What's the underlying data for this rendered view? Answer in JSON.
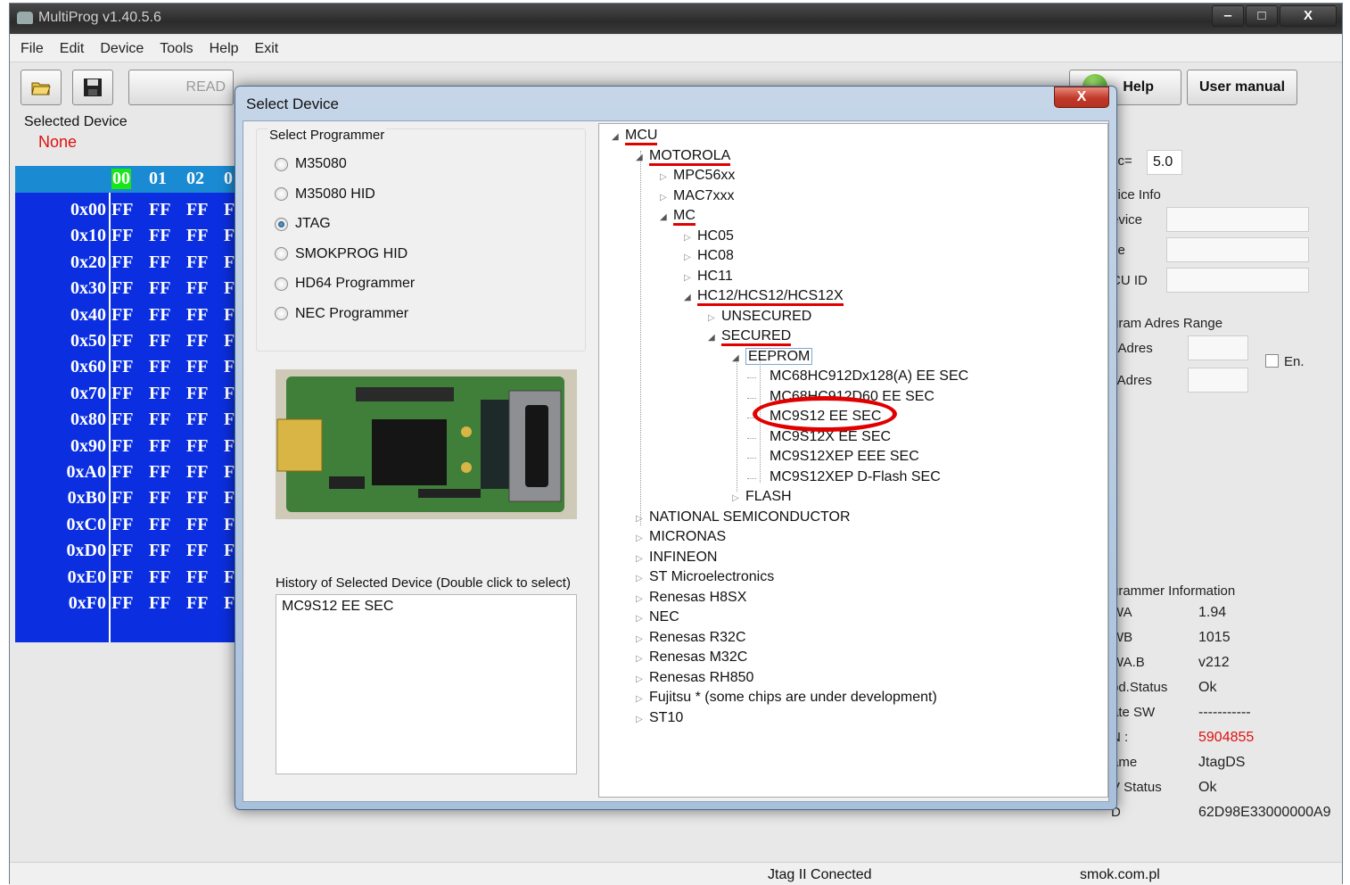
{
  "window": {
    "title": "MultiProg v1.40.5.6",
    "controls": [
      "‒",
      "□",
      "X"
    ]
  },
  "menu": [
    "File",
    "Edit",
    "Device",
    "Tools",
    "Help",
    "Exit"
  ],
  "toolbar": {
    "read_label": "READ",
    "help_label": "Help",
    "manual_label": "User manual"
  },
  "selected_device": {
    "label": "Selected Device",
    "value": "None"
  },
  "hex": {
    "header": [
      "00",
      "01",
      "02",
      "0"
    ],
    "rows": [
      {
        "addr": "0x00",
        "cells": [
          "FF",
          "FF",
          "FF",
          "F"
        ]
      },
      {
        "addr": "0x10",
        "cells": [
          "FF",
          "FF",
          "FF",
          "F"
        ]
      },
      {
        "addr": "0x20",
        "cells": [
          "FF",
          "FF",
          "FF",
          "F"
        ]
      },
      {
        "addr": "0x30",
        "cells": [
          "FF",
          "FF",
          "FF",
          "F"
        ]
      },
      {
        "addr": "0x40",
        "cells": [
          "FF",
          "FF",
          "FF",
          "F"
        ]
      },
      {
        "addr": "0x50",
        "cells": [
          "FF",
          "FF",
          "FF",
          "F"
        ]
      },
      {
        "addr": "0x60",
        "cells": [
          "FF",
          "FF",
          "FF",
          "F"
        ]
      },
      {
        "addr": "0x70",
        "cells": [
          "FF",
          "FF",
          "FF",
          "F"
        ]
      },
      {
        "addr": "0x80",
        "cells": [
          "FF",
          "FF",
          "FF",
          "F"
        ]
      },
      {
        "addr": "0x90",
        "cells": [
          "FF",
          "FF",
          "FF",
          "F"
        ]
      },
      {
        "addr": "0xA0",
        "cells": [
          "FF",
          "FF",
          "FF",
          "F"
        ]
      },
      {
        "addr": "0xB0",
        "cells": [
          "FF",
          "FF",
          "FF",
          "F"
        ]
      },
      {
        "addr": "0xC0",
        "cells": [
          "FF",
          "FF",
          "FF",
          "F"
        ]
      },
      {
        "addr": "0xD0",
        "cells": [
          "FF",
          "FF",
          "FF",
          "F"
        ]
      },
      {
        "addr": "0xE0",
        "cells": [
          "FF",
          "FF",
          "FF",
          "F"
        ]
      },
      {
        "addr": "0xF0",
        "cells": [
          "FF",
          "FF",
          "FF",
          "F"
        ]
      }
    ]
  },
  "right_panel": {
    "vcc_label": "cc=",
    "vcc_value": "5.0",
    "device_info_title": "vice Info",
    "device_label": "evice",
    "size_label": "ze",
    "mcu_id_label": "CU ID",
    "adres_range_title": "gram Adres Range",
    "start_adres_label": "t Adres",
    "end_adres_label": "l  Adres",
    "enable_label": "En.",
    "programmer_info_title": "grammer Information",
    "rows": [
      {
        "label": "WA",
        "value": "1.94"
      },
      {
        "label": "WB",
        "value": "1015"
      },
      {
        "label": "WA.B",
        "value": "v212"
      },
      {
        "label": "pd.Status",
        "value": "Ok"
      },
      {
        "label": "ate  SW",
        "value": "-----------"
      },
      {
        "label": "N :",
        "value": "5904855"
      },
      {
        "label": "ame",
        "value": "JtagDS"
      },
      {
        "label": "V Status",
        "value": "Ok"
      },
      {
        "label": "D",
        "value": "62D98E33000000A9"
      }
    ],
    "sn_color": "#e01010"
  },
  "status_bar": {
    "connection": "Jtag II Conected",
    "website": "smok.com.pl"
  },
  "dialog": {
    "title": "Select Device",
    "close": "X",
    "programmer_group_title": "Select Programmer",
    "programmers": [
      {
        "label": "M35080",
        "checked": false
      },
      {
        "label": "M35080 HID",
        "checked": false
      },
      {
        "label": "JTAG",
        "checked": true
      },
      {
        "label": "SMOKPROG HID",
        "checked": false
      },
      {
        "label": "HD64 Programmer",
        "checked": false
      },
      {
        "label": "NEC Programmer",
        "checked": false
      }
    ],
    "history_label": "History of Selected Device (Double click to select)",
    "history_items": [
      "MC9S12 EE SEC"
    ],
    "tree": [
      {
        "label": "MCU",
        "level": 0,
        "state": "expanded",
        "marked": true
      },
      {
        "label": "MOTOROLA",
        "level": 1,
        "state": "expanded",
        "marked": true
      },
      {
        "label": "MPC56xx",
        "level": 2,
        "state": "collapsed"
      },
      {
        "label": "MAC7xxx",
        "level": 2,
        "state": "collapsed"
      },
      {
        "label": "MC",
        "level": 2,
        "state": "expanded",
        "marked": true
      },
      {
        "label": "HC05",
        "level": 3,
        "state": "collapsed"
      },
      {
        "label": "HC08",
        "level": 3,
        "state": "collapsed"
      },
      {
        "label": "HC11",
        "level": 3,
        "state": "collapsed"
      },
      {
        "label": "HC12/HCS12/HCS12X",
        "level": 3,
        "state": "expanded",
        "marked": true
      },
      {
        "label": "UNSECURED",
        "level": 4,
        "state": "collapsed"
      },
      {
        "label": "SECURED",
        "level": 4,
        "state": "expanded",
        "marked": true
      },
      {
        "label": "EEPROM",
        "level": 5,
        "state": "expanded",
        "marked": true,
        "selected": true
      },
      {
        "label": "MC68HC912Dx128(A) EE SEC",
        "level": 6,
        "state": "leaf"
      },
      {
        "label": "MC68HC912D60 EE SEC",
        "level": 6,
        "state": "leaf"
      },
      {
        "label": "MC9S12 EE SEC",
        "level": 6,
        "state": "leaf",
        "circled": true
      },
      {
        "label": "MC9S12X EE SEC",
        "level": 6,
        "state": "leaf"
      },
      {
        "label": "MC9S12XEP EEE SEC",
        "level": 6,
        "state": "leaf"
      },
      {
        "label": "MC9S12XEP D-Flash SEC",
        "level": 6,
        "state": "leaf"
      },
      {
        "label": "FLASH",
        "level": 5,
        "state": "collapsed"
      },
      {
        "label": "NATIONAL SEMICONDUCTOR",
        "level": 1,
        "state": "collapsed"
      },
      {
        "label": "MICRONAS",
        "level": 1,
        "state": "collapsed"
      },
      {
        "label": "INFINEON",
        "level": 1,
        "state": "collapsed"
      },
      {
        "label": "ST Microelectronics",
        "level": 1,
        "state": "collapsed"
      },
      {
        "label": "Renesas H8SX",
        "level": 1,
        "state": "collapsed"
      },
      {
        "label": "NEC",
        "level": 1,
        "state": "collapsed"
      },
      {
        "label": "Renesas R32C",
        "level": 1,
        "state": "collapsed"
      },
      {
        "label": "Renesas M32C",
        "level": 1,
        "state": "collapsed"
      },
      {
        "label": "Renesas RH850",
        "level": 1,
        "state": "collapsed"
      },
      {
        "label": "Fujitsu * (some chips are under development)",
        "level": 1,
        "state": "collapsed"
      },
      {
        "label": "ST10",
        "level": 1,
        "state": "collapsed"
      }
    ],
    "annotation_color": "#e00000"
  }
}
